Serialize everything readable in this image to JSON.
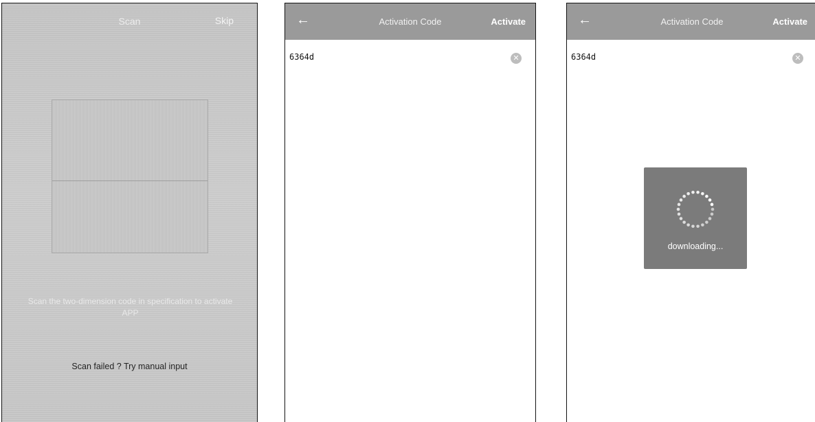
{
  "scan_screen": {
    "title": "Scan",
    "skip_label": "Skip",
    "hint": "Scan the two-dimension code in specification to activate APP",
    "manual_input_label": "Scan failed ? Try manual input"
  },
  "activation_screen": {
    "back_label": "←",
    "title": "Activation Code",
    "activate_label": "Activate",
    "code_value": "6364d",
    "clear_icon": "⊗"
  },
  "activation_loading_screen": {
    "back_label": "←",
    "title": "Activation Code",
    "activate_label": "Activate",
    "code_value": "6364d",
    "clear_icon": "⊗",
    "loading_text": "downloading..."
  }
}
